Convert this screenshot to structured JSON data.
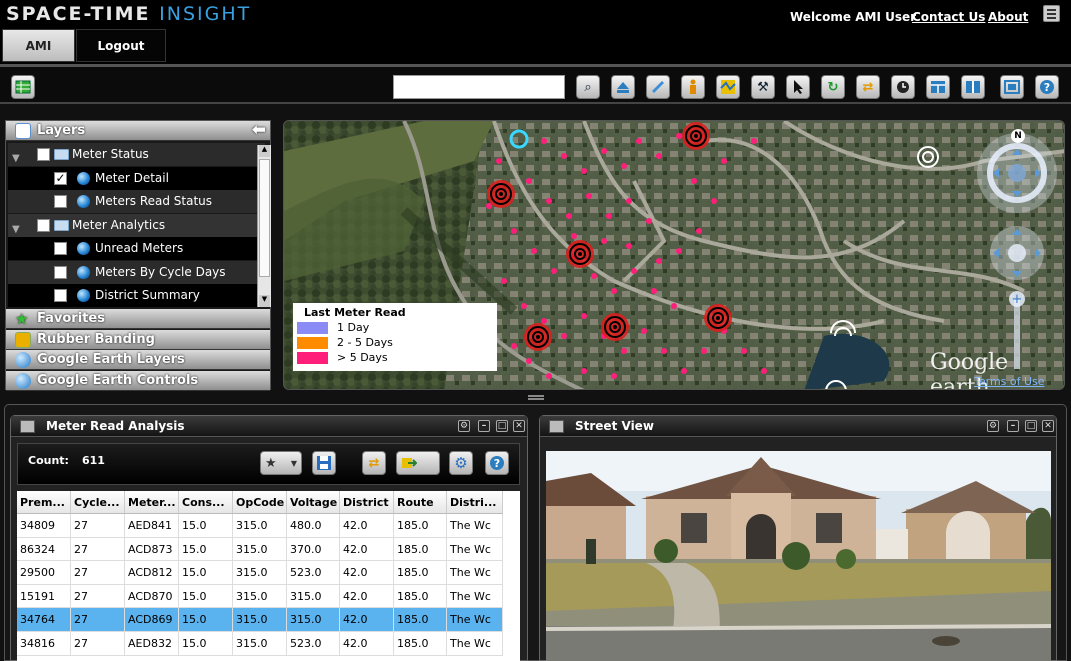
{
  "header": {
    "logo_part1": "SPACE-TIME",
    "logo_part2": "INSIGHT",
    "welcome": "Welcome AMI User",
    "contact": "Contact Us",
    "about": "About"
  },
  "tabs": [
    {
      "label": "AMI",
      "active": true
    },
    {
      "label": "Logout",
      "active": false
    }
  ],
  "toolbar": {
    "search_placeholder": "",
    "buttons": [
      "grid-icon",
      "binoculars-icon",
      "eject-icon",
      "ruler-icon",
      "person-icon",
      "map-icon",
      "walk-icon",
      "pointer-icon",
      "refresh-icon",
      "sync-icon",
      "clock-icon",
      "layout-icon",
      "columns-icon",
      "fullscreen-icon",
      "help-icon"
    ]
  },
  "layers": {
    "title": "Layers",
    "tree": [
      {
        "label": "Meter Status",
        "level": 0,
        "checked": false,
        "type": "folder"
      },
      {
        "label": "Meter Detail",
        "level": 1,
        "checked": true,
        "type": "layer"
      },
      {
        "label": "Meters Read Status",
        "level": 1,
        "checked": false,
        "type": "layer"
      },
      {
        "label": "Meter Analytics",
        "level": 0,
        "checked": false,
        "type": "folder"
      },
      {
        "label": "Unread Meters",
        "level": 1,
        "checked": false,
        "type": "layer"
      },
      {
        "label": "Meters By Cycle Days",
        "level": 1,
        "checked": false,
        "type": "layer"
      },
      {
        "label": "District Summary",
        "level": 1,
        "checked": false,
        "type": "layer"
      }
    ],
    "sections": [
      "Favorites",
      "Rubber Banding",
      "Google Earth Layers",
      "Google Earth Controls"
    ]
  },
  "map": {
    "compass_n": "N",
    "brand": "Google earth",
    "terms": "Terms of Use",
    "legend": {
      "title": "Last Meter Read",
      "items": [
        {
          "label": "1 Day",
          "color": "#8b8bf5"
        },
        {
          "label": "2 - 5 Days",
          "color": "#ff8c00"
        },
        {
          "label": "> 5 Days",
          "color": "#ff1f7a"
        }
      ]
    }
  },
  "meter_read_analysis": {
    "title": "Meter Read Analysis",
    "count_label": "Count:",
    "count_value": "611",
    "columns": [
      "Prem...",
      "Cycle...",
      "Meter...",
      "Cons...",
      "OpCode",
      "Voltage",
      "District",
      "Route",
      "Distri..."
    ],
    "rows": [
      [
        "34809",
        "27",
        "AED841",
        "15.0",
        "315.0",
        "480.0",
        "42.0",
        "185.0",
        "The Wc"
      ],
      [
        "86324",
        "27",
        "ACD873",
        "15.0",
        "315.0",
        "370.0",
        "42.0",
        "185.0",
        "The Wc"
      ],
      [
        "29500",
        "27",
        "ACD812",
        "15.0",
        "315.0",
        "523.0",
        "42.0",
        "185.0",
        "The Wc"
      ],
      [
        "15191",
        "27",
        "ACD870",
        "15.0",
        "315.0",
        "315.0",
        "42.0",
        "185.0",
        "The Wc"
      ],
      [
        "34764",
        "27",
        "ACD869",
        "15.0",
        "315.0",
        "315.0",
        "42.0",
        "185.0",
        "The Wc"
      ],
      [
        "34816",
        "27",
        "AED832",
        "15.0",
        "315.0",
        "523.0",
        "42.0",
        "185.0",
        "The Wc"
      ]
    ],
    "selected_row": 4
  },
  "street_view": {
    "title": "Street View"
  }
}
